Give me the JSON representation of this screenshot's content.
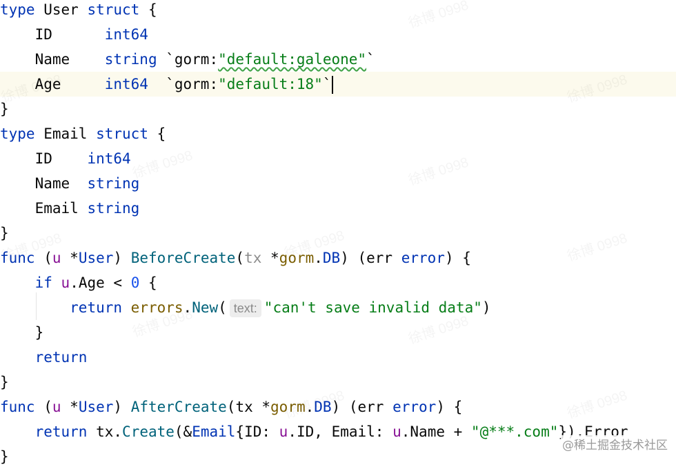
{
  "code_lines": [
    "type User struct {",
    "    ID      int64",
    "    Name    string `gorm:\"default:galeone\"`",
    "    Age     int64  `gorm:\"default:18\"`",
    "}",
    "type Email struct {",
    "    ID    int64",
    "    Name  string",
    "    Email string",
    "}",
    "func (u *User) BeforeCreate(tx *gorm.DB) (err error) {",
    "    if u.Age < 0 {",
    "        return errors.New(text: \"can't save invalid data\")",
    "    }",
    "    return",
    "}",
    "func (u *User) AfterCreate(tx *gorm.DB) (err error) {",
    "    return tx.Create(&Email{ID: u.ID, Email: u.Name + \"@***.com\"}).Error",
    "}"
  ],
  "tokens": {
    "type_kw": "type",
    "struct_kw": "struct",
    "func_kw": "func",
    "if_kw": "if",
    "return_kw": "return",
    "user_type": "User",
    "email_type": "Email",
    "id_field": "ID",
    "name_field": "Name",
    "age_field": "Age",
    "email_field": "Email",
    "int64_type": "int64",
    "string_type": "string",
    "error_type": "error",
    "gorm_pkg": "gorm",
    "errors_pkg": "errors",
    "db_type": "DB",
    "before_create": "BeforeCreate",
    "after_create": "AfterCreate",
    "new_fn": "New",
    "create_fn": "Create",
    "error_prop": "Error",
    "recv_u": "u",
    "param_tx": "tx",
    "param_err": "err",
    "tag_name_str": "\"default:galeone\"",
    "tag_age_str": "\"default:18\"",
    "err_msg_str": "\"can't save invalid data\"",
    "email_suffix_str": "\"@***.com\"",
    "zero_num": "0",
    "param_hint": "text:"
  },
  "watermark_text": "徐博 0998",
  "brand_text": "@稀土掘金技术社区",
  "colors": {
    "keyword": "#0033b3",
    "function": "#00627a",
    "string": "#067d17",
    "package": "#7a5d00",
    "parameter": "#871094",
    "number": "#1750eb",
    "current_line": "#fcfaed"
  }
}
